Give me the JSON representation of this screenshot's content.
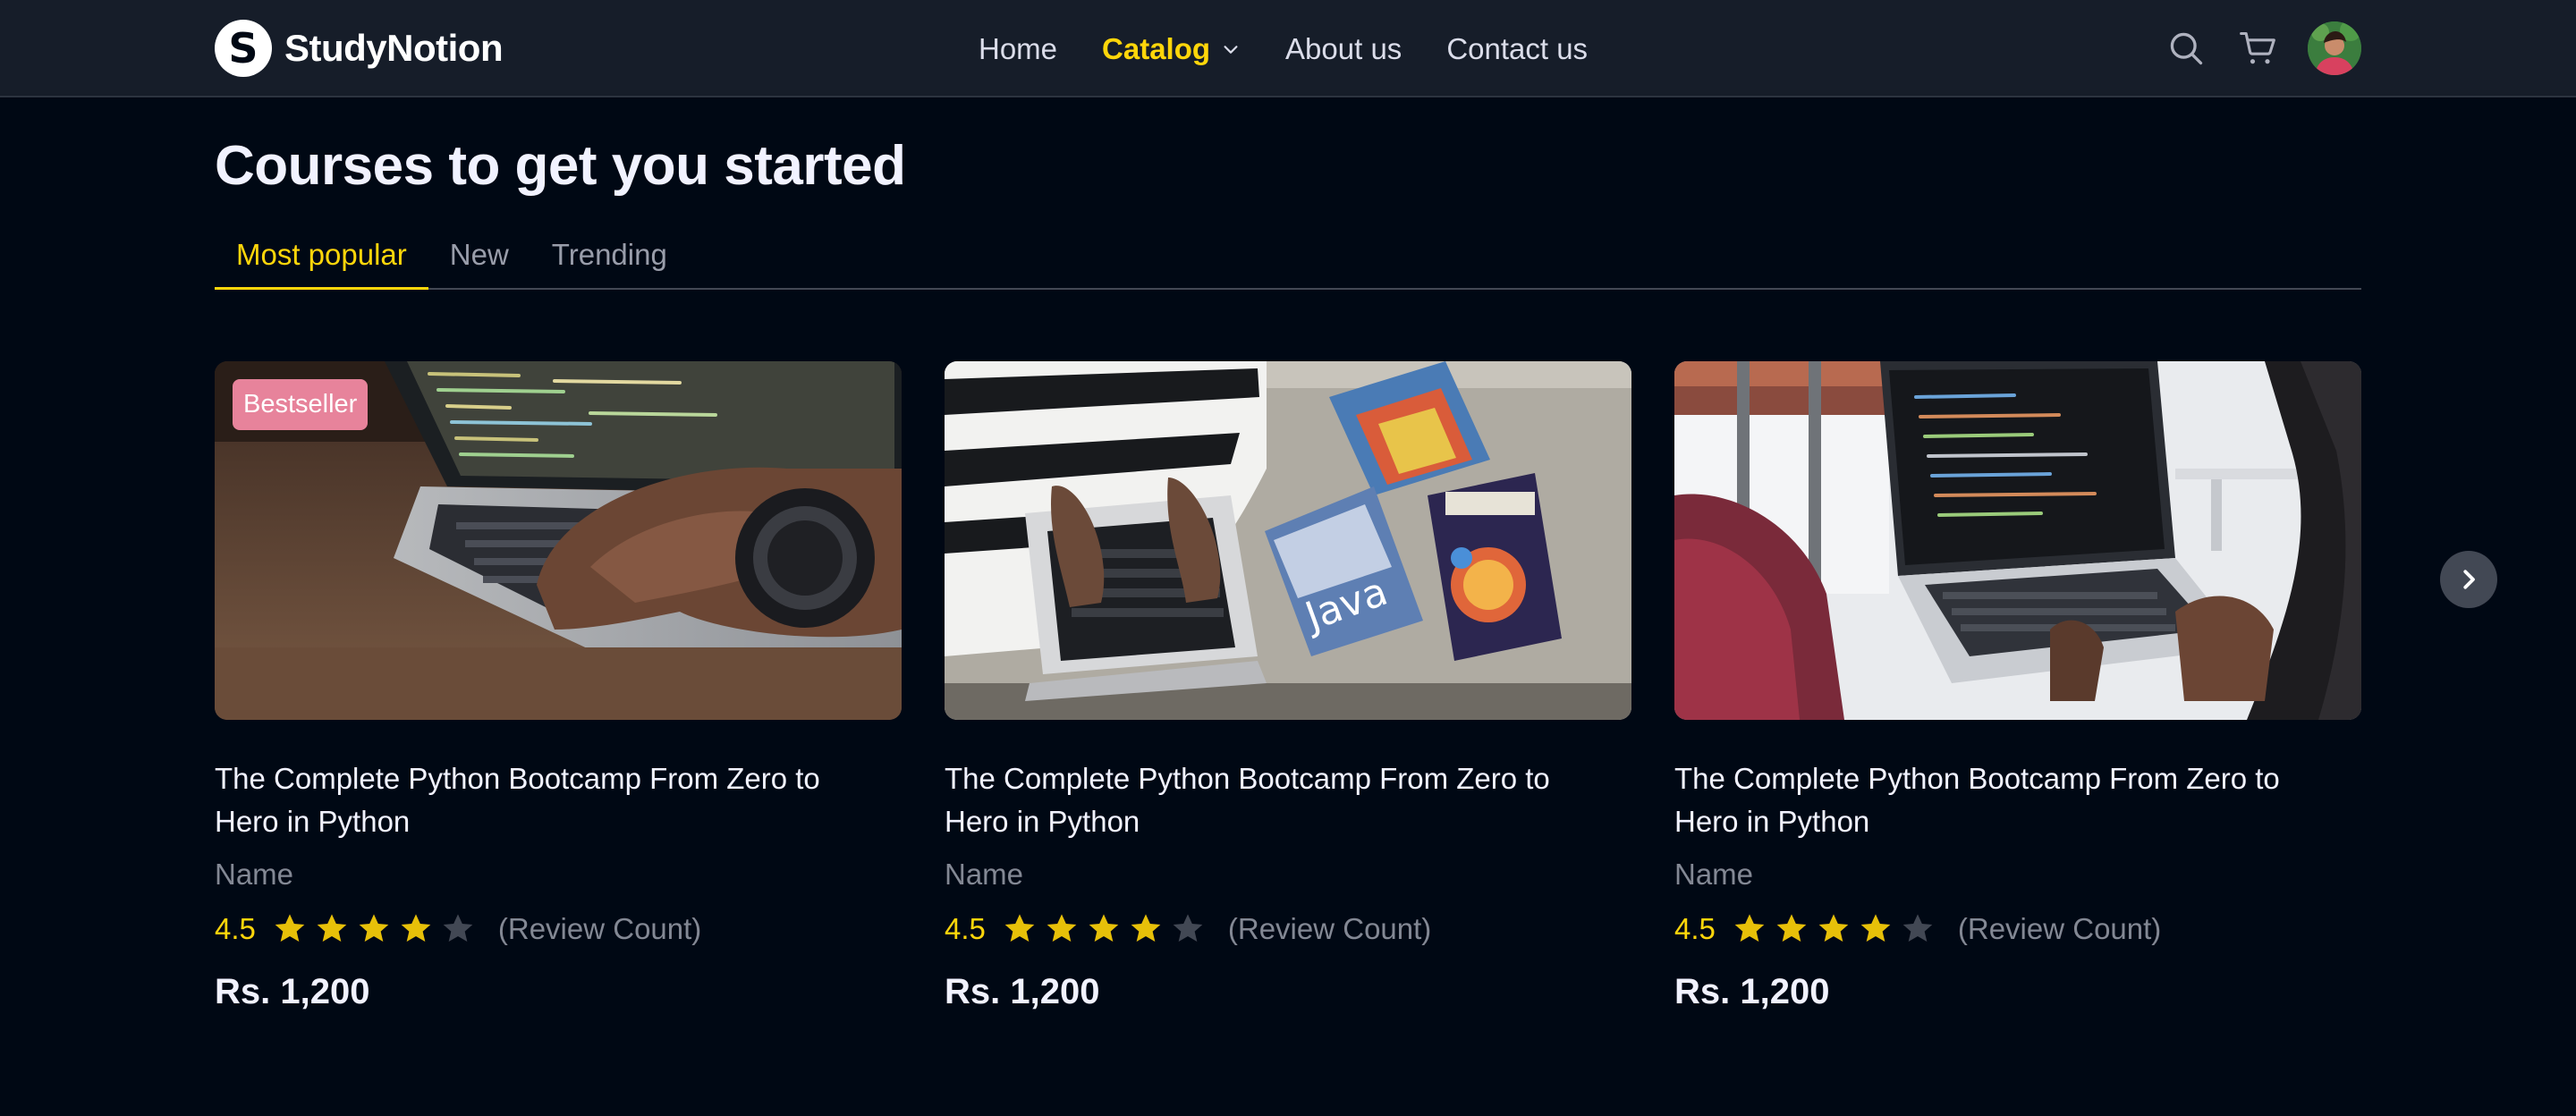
{
  "navbar": {
    "brand": "StudyNotion",
    "brand_mark": "S",
    "links": [
      {
        "label": "Home"
      },
      {
        "label": "Catalog"
      },
      {
        "label": "About us"
      },
      {
        "label": "Contact us"
      }
    ],
    "icons": [
      "search-icon",
      "cart-icon",
      "avatar"
    ]
  },
  "section": {
    "title": "Courses to get you started",
    "tabs": [
      {
        "label": "Most popular",
        "active": true
      },
      {
        "label": "New",
        "active": false
      },
      {
        "label": "Trending",
        "active": false
      }
    ]
  },
  "courses": [
    {
      "badge": "Bestseller",
      "title": "The Complete Python Bootcamp From Zero to Hero in Python",
      "name": "Name",
      "rating": "4.5",
      "rating_value": 4.5,
      "review": "(Review Count)",
      "price": "Rs. 1,200"
    },
    {
      "badge": "",
      "title": "The Complete Python Bootcamp From Zero to Hero in Python",
      "name": "Name",
      "rating": "4.5",
      "rating_value": 4.5,
      "review": "(Review Count)",
      "price": "Rs. 1,200"
    },
    {
      "badge": "",
      "title": "The Complete Python Bootcamp From Zero to Hero in Python",
      "name": "Name",
      "rating": "4.5",
      "rating_value": 4.5,
      "review": "(Review Count)",
      "price": "Rs. 1,200"
    }
  ],
  "colors": {
    "accent": "#ffd60a",
    "badge": "#e7839b",
    "star_filled": "#e7c009",
    "star_empty": "#424854"
  }
}
